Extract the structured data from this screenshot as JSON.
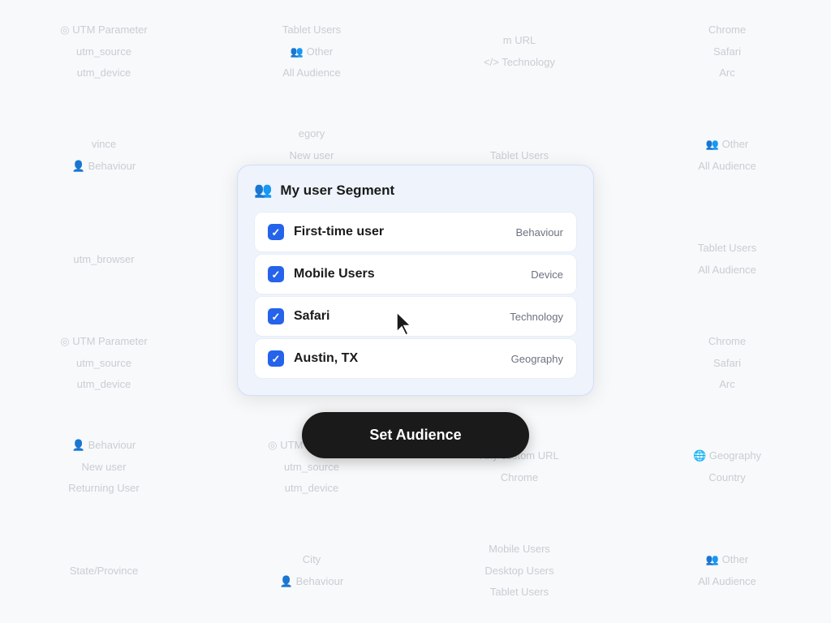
{
  "background": {
    "columns": [
      [
        {
          "icon": "◎",
          "lines": [
            "UTM Parameter",
            "utm_source",
            "utm_device",
            "utm_browser"
          ]
        },
        {
          "icon": "</>",
          "lines": [
            "Technology",
            "Chrome",
            "Safari",
            "Arc"
          ]
        },
        {
          "icon": "👤",
          "lines": [
            "Behaviour",
            "New user",
            "Returning User",
            ""
          ]
        },
        {
          "icon": "◎",
          "lines": [
            "UTM Parameter",
            "utm_source",
            "utm_device",
            "utm_browser"
          ]
        },
        {
          "icon": "",
          "lines": [
            "Tablet Users",
            "",
            "All Audience",
            ""
          ]
        },
        {
          "icon": "👤",
          "lines": [
            "Other",
            "",
            "All Audience",
            ""
          ]
        }
      ],
      [
        {
          "icon": "",
          "lines": [
            "Tablet Users",
            "",
            "All Audience",
            ""
          ]
        },
        {
          "icon": "👤",
          "lines": [
            "Other",
            "",
            "All Audience",
            ""
          ]
        },
        {
          "icon": "",
          "lines": [
            "Desktop",
            "",
            "Tablet Users",
            ""
          ]
        },
        {
          "icon": "👤",
          "lines": [
            "Other",
            "",
            "All Audience",
            ""
          ]
        },
        {
          "icon": "◎",
          "lines": [
            "UTM Parameter",
            "utm_source",
            "utm_device",
            "utm_browser"
          ]
        },
        {
          "icon": "",
          "lines": [
            "Tablet Users",
            "",
            "All Audience",
            ""
          ]
        }
      ],
      [
        {
          "icon": "◎",
          "lines": [
            "UTM Parameter",
            "utm_source",
            "utm_device",
            "utm_browser"
          ]
        },
        {
          "icon": "</>",
          "lines": [
            "Technology",
            "Chrome",
            "Safari",
            "Arc"
          ]
        },
        {
          "icon": "👤",
          "lines": [
            "Behaviour",
            "New user",
            "Returning User",
            ""
          ]
        },
        {
          "icon": "",
          "lines": [
            "Device category",
            "Mobile Users",
            "",
            ""
          ]
        },
        {
          "icon": "◎",
          "lines": [
            "UTM Parameter",
            "utm_source",
            "utm_device",
            "utm_browser"
          ]
        },
        {
          "icon": "",
          "lines": [
            "Tablet Users",
            "",
            "All Audience",
            ""
          ]
        }
      ],
      [
        {
          "icon": "",
          "lines": [
            "Any custom URL",
            "",
            "",
            ""
          ]
        },
        {
          "icon": "🌐",
          "lines": [
            "Geography",
            "Country",
            "State/Province",
            "City"
          ]
        },
        {
          "icon": "👤",
          "lines": [
            "Behaviour",
            "New user",
            "Returning User",
            ""
          ]
        },
        {
          "icon": "",
          "lines": [
            "",
            "Mobile Users",
            "Desktop Users",
            "Tablet Users"
          ]
        },
        {
          "icon": "👤",
          "lines": [
            "Other",
            "",
            "All Audience",
            ""
          ]
        },
        {
          "icon": "",
          "lines": [
            "Other",
            "",
            "All Audience",
            ""
          ]
        }
      ]
    ]
  },
  "modal": {
    "title": "My user Segment",
    "items": [
      {
        "name": "First-time user",
        "tag": "Behaviour",
        "checked": true
      },
      {
        "name": "Mobile Users",
        "tag": "Device",
        "checked": true
      },
      {
        "name": "Safari",
        "tag": "Technology",
        "checked": true
      },
      {
        "name": "Austin, TX",
        "tag": "Geography",
        "checked": true
      }
    ]
  },
  "button": {
    "label": "Set Audience"
  }
}
